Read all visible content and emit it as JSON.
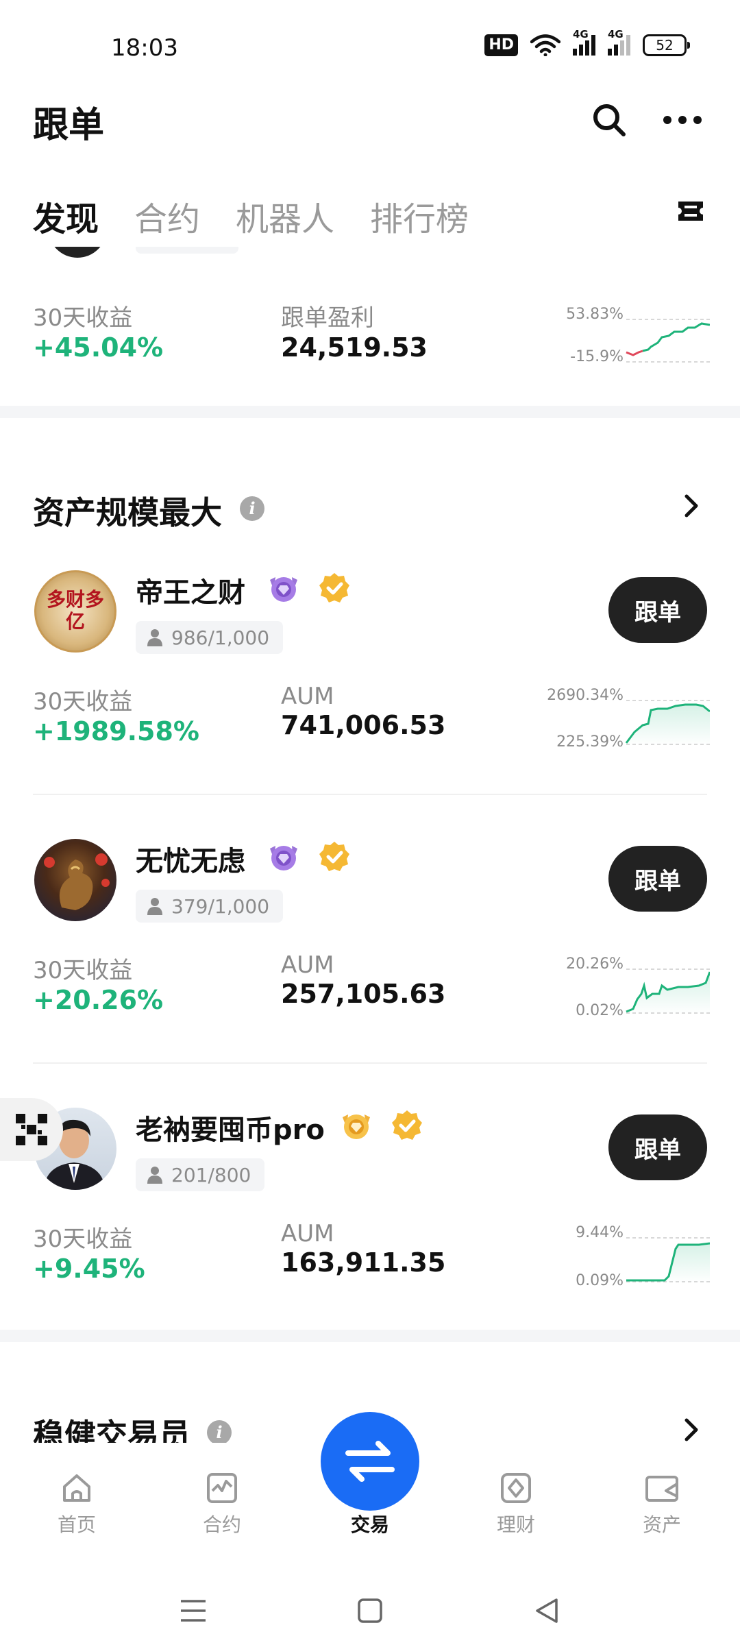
{
  "status_bar": {
    "time": "18:03",
    "hd_label": "HD",
    "signal1_label": "4G",
    "signal2_label": "4G",
    "battery": "52"
  },
  "header": {
    "title": "跟单"
  },
  "tabs": [
    {
      "label": "发现",
      "active": true
    },
    {
      "label": "合约",
      "active": false
    },
    {
      "label": "机器人",
      "active": false
    },
    {
      "label": "排行榜",
      "active": false
    }
  ],
  "top_card": {
    "return_label": "30天收益",
    "return_value": "+45.04%",
    "profit_label": "跟单盈利",
    "profit_value": "24,519.53",
    "chart_max": "53.83%",
    "chart_min": "-15.9%"
  },
  "section_largest": {
    "title": "资产规模最大",
    "traders": [
      {
        "name": "帝王之财",
        "followers": "986/1,000",
        "return_label": "30天收益",
        "return_value": "+1989.58%",
        "aum_label": "AUM",
        "aum_value": "741,006.53",
        "chart_max": "2690.34%",
        "chart_min": "225.39%",
        "button": "跟单",
        "avatar_text": "多财多亿"
      },
      {
        "name": "无忧无虑",
        "followers": "379/1,000",
        "return_label": "30天收益",
        "return_value": "+20.26%",
        "aum_label": "AUM",
        "aum_value": "257,105.63",
        "chart_max": "20.26%",
        "chart_min": "0.02%",
        "button": "跟单"
      },
      {
        "name": "老衲要囤币pro",
        "followers": "201/800",
        "return_label": "30天收益",
        "return_value": "+9.45%",
        "aum_label": "AUM",
        "aum_value": "163,911.35",
        "chart_max": "9.44%",
        "chart_min": "0.09%",
        "button": "跟单"
      }
    ]
  },
  "section_steady": {
    "title": "稳健交易员"
  },
  "bottom_nav": [
    {
      "label": "首页",
      "icon": "home-icon"
    },
    {
      "label": "合约",
      "icon": "futures-chart-icon"
    },
    {
      "label": "交易",
      "icon": "swap-arrows-icon",
      "active": true
    },
    {
      "label": "理财",
      "icon": "finance-diamond-icon"
    },
    {
      "label": "资产",
      "icon": "wallet-icon"
    }
  ],
  "colors": {
    "gain_green": "#1eb37a",
    "loss_red": "#e0475a",
    "accent_blue": "#1a6cf5",
    "button_dark": "#222222"
  }
}
